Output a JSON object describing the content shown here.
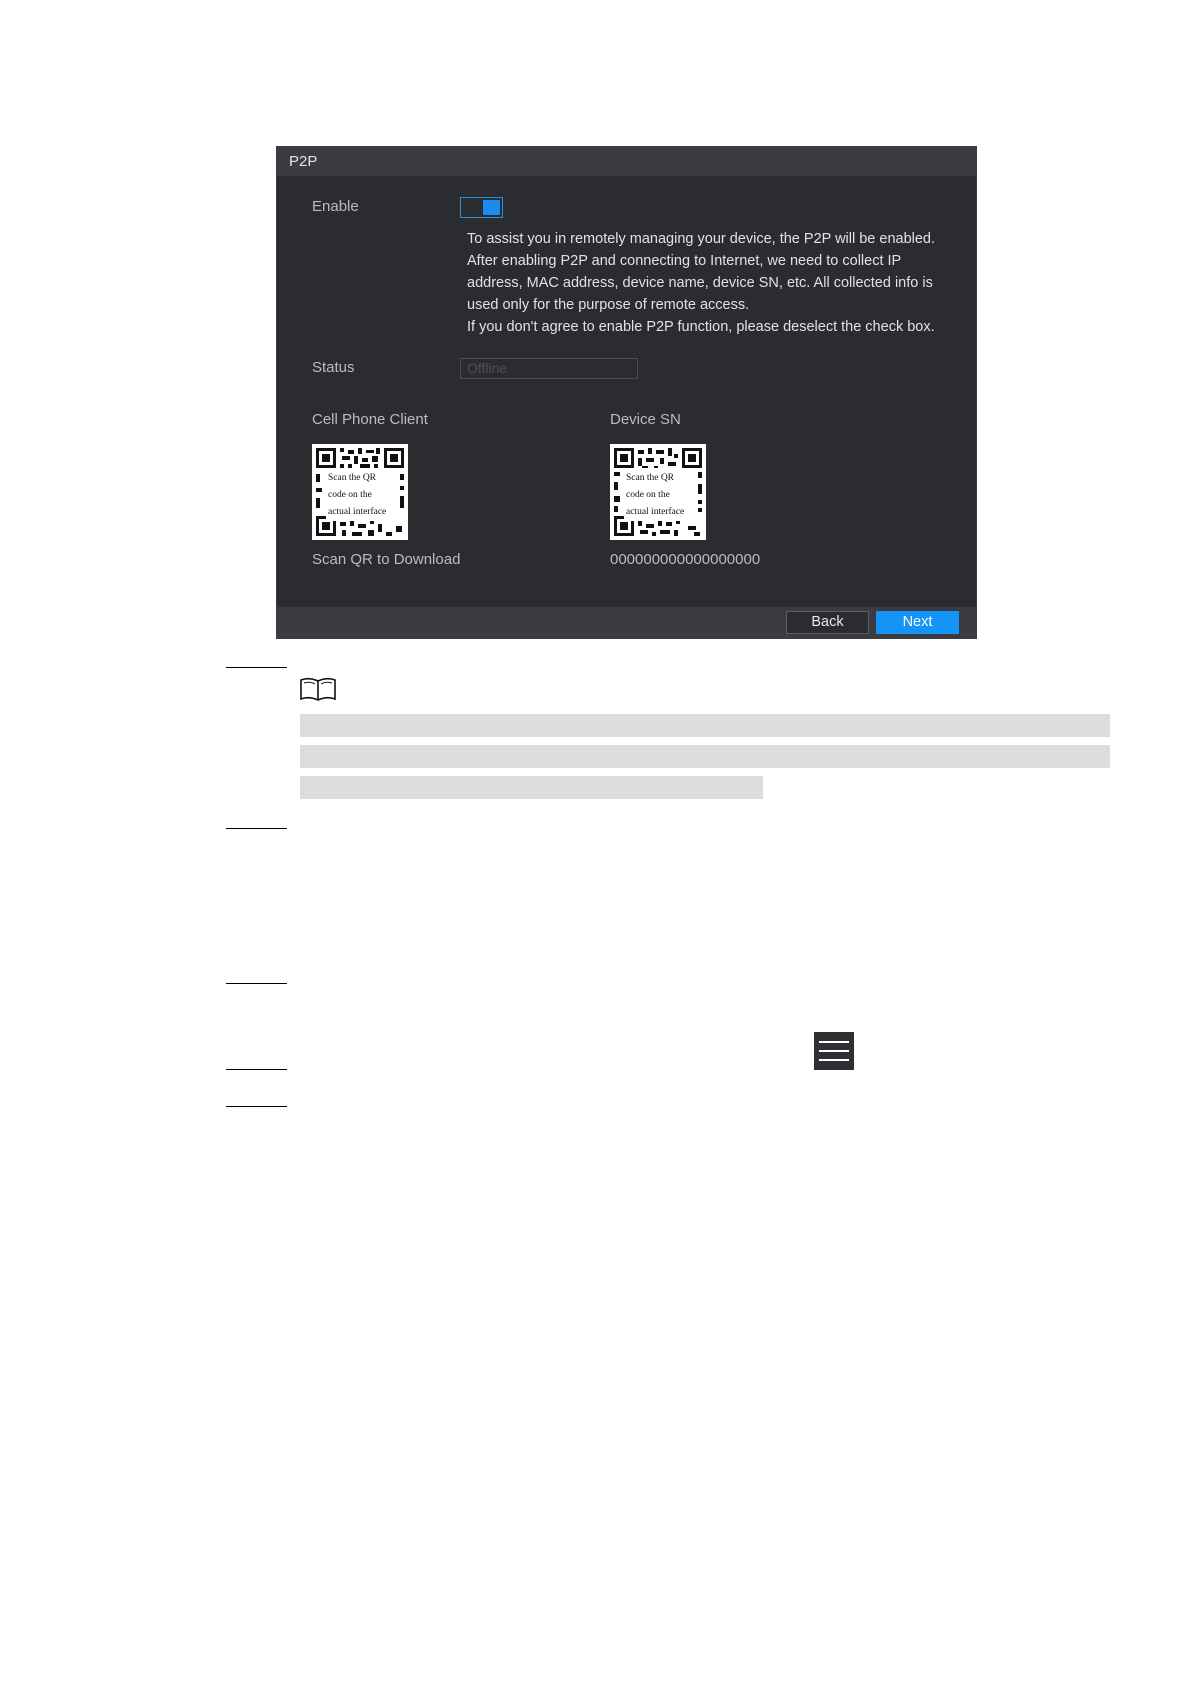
{
  "dialog": {
    "title": "P2P",
    "enable_label": "Enable",
    "info_lines": [
      "To assist you in remotely managing your device, the P2P will be enabled.",
      "After enabling P2P and connecting to Internet, we need to collect  IP",
      "address, MAC address, device name, device SN, etc. All collected info is",
      "used only for the purpose of remote access.",
      "If you don't agree to enable P2P function, please deselect the check box."
    ],
    "status_label": "Status",
    "status_value": "Offline",
    "cell_phone_label": "Cell Phone Client",
    "device_sn_label": "Device SN",
    "qr_note": [
      "Scan the QR",
      "code on the",
      "actual interface"
    ],
    "scan_caption": "Scan QR to Download",
    "device_sn_value": "000000000000000000",
    "back_label": "Back",
    "next_label": "Next"
  },
  "colors": {
    "dialog_bg": "#2b2c30",
    "titlebar_bg": "#3b3c41",
    "accent": "#1494f6",
    "note_highlight": "#dcdcdc"
  },
  "icons": {
    "note": "book-icon",
    "menu": "hamburger-menu-icon"
  }
}
